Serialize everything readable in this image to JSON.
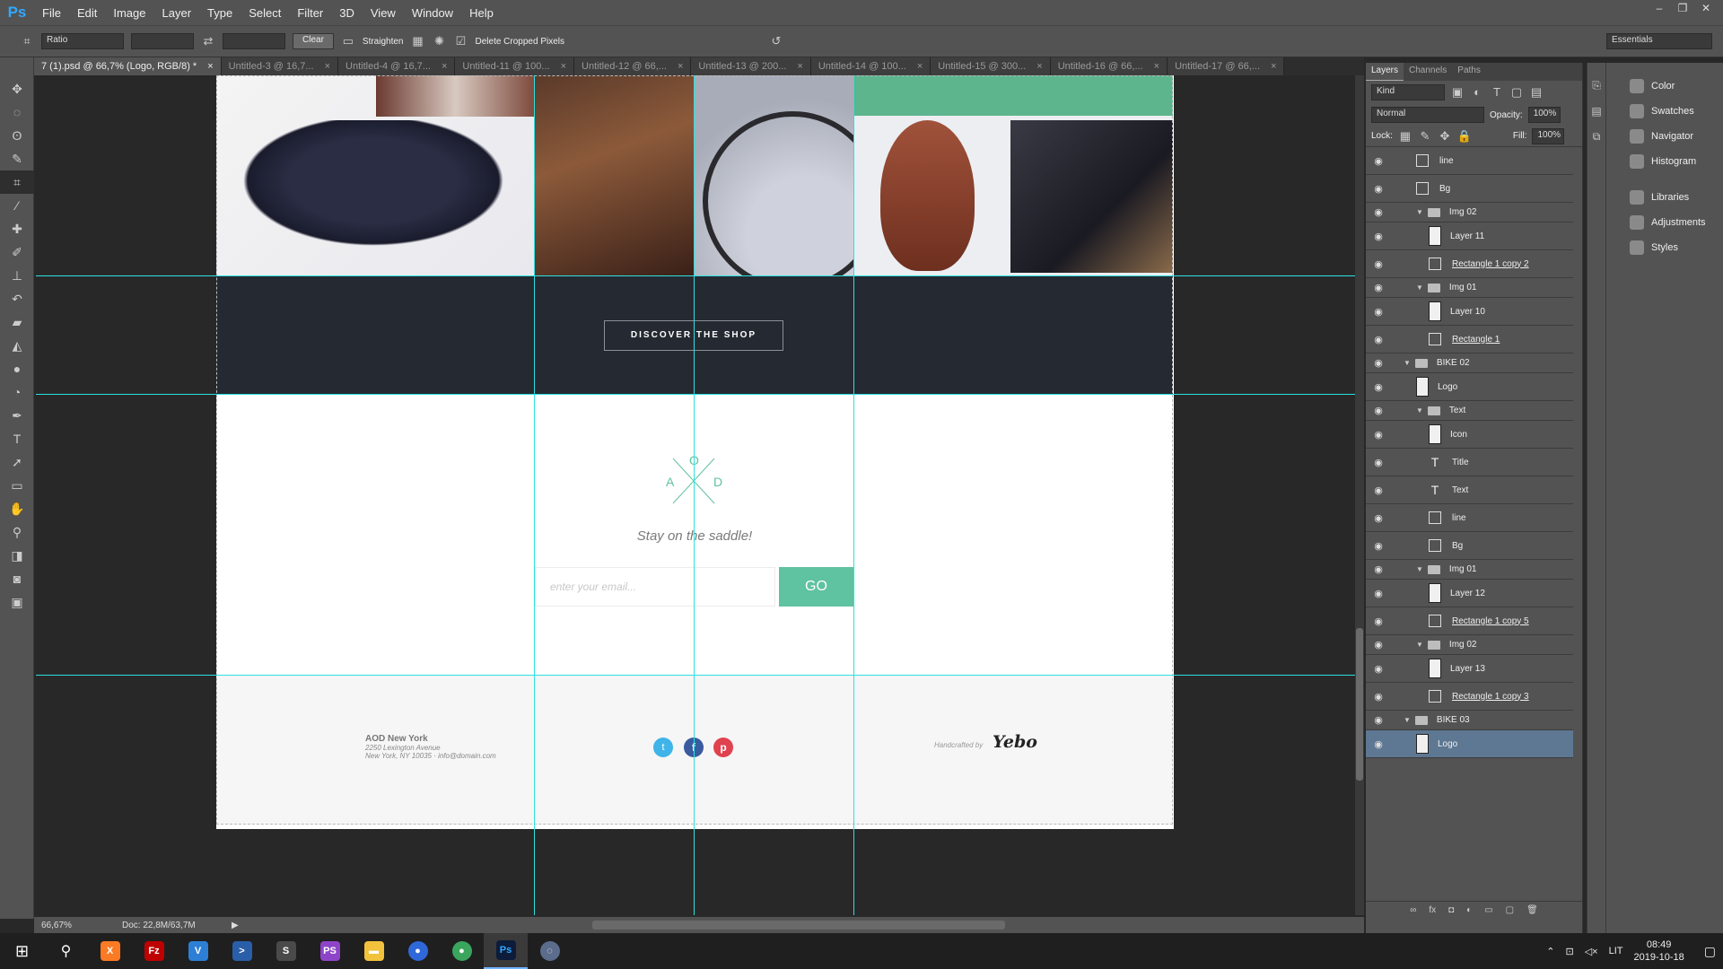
{
  "app": {
    "logo": "Ps",
    "menus": [
      "File",
      "Edit",
      "Image",
      "Layer",
      "Type",
      "Select",
      "Filter",
      "3D",
      "View",
      "Window",
      "Help"
    ],
    "window_controls": [
      "–",
      "❐",
      "✕"
    ]
  },
  "options": {
    "ratio": "Ratio",
    "clear": "Clear",
    "straighten": "Straighten",
    "delete_cropped": "Delete Cropped Pixels",
    "workspace": "Essentials"
  },
  "tabs": [
    "7 (1).psd @ 66,7% (Logo, RGB/8) *",
    "Untitled-3 @ 16,7...",
    "Untitled-4 @ 16,7...",
    "Untitled-11 @ 100...",
    "Untitled-12 @ 66,...",
    "Untitled-13 @ 200...",
    "Untitled-14 @ 100...",
    "Untitled-15 @ 300...",
    "Untitled-16 @ 66,...",
    "Untitled-17 @ 66,..."
  ],
  "design": {
    "cta": "DISCOVER THE SHOP",
    "logo_letters": {
      "top": "O",
      "left": "A",
      "right": "D"
    },
    "tagline": "Stay on the saddle!",
    "email_placeholder": "enter your email...",
    "go": "GO",
    "footer": {
      "company": "AOD New York",
      "address": "2250 Lexington Avenue",
      "city": "New York, NY 10035 · info@domain.com",
      "handcrafted": "Handcrafted by",
      "brand": "Yebo"
    },
    "accent": "#5fc2a0"
  },
  "status": {
    "zoom": "66,67%",
    "doc": "Doc: 22,8M/63,7M"
  },
  "panels": {
    "tabs": [
      "Layers",
      "Channels",
      "Paths"
    ],
    "kind": "Kind",
    "blend": "Normal",
    "opacity_label": "Opacity:",
    "opacity": "100%",
    "lock_label": "Lock:",
    "fill_label": "Fill:",
    "fill": "100%",
    "layers": [
      {
        "name": "line",
        "type": "shape",
        "indent": 2
      },
      {
        "name": "Bg",
        "type": "shape",
        "indent": 2
      },
      {
        "name": "Img 02",
        "type": "group",
        "indent": 2
      },
      {
        "name": "Layer 11",
        "type": "pixel",
        "indent": 3
      },
      {
        "name": "Rectangle 1 copy 2",
        "type": "shape",
        "indent": 3,
        "u": true
      },
      {
        "name": "Img 01",
        "type": "group",
        "indent": 2
      },
      {
        "name": "Layer 10",
        "type": "pixel",
        "indent": 3
      },
      {
        "name": "Rectangle 1",
        "type": "shape",
        "indent": 3,
        "u": true
      },
      {
        "name": "BIKE 02",
        "type": "group",
        "indent": 1
      },
      {
        "name": "Logo",
        "type": "pixel",
        "indent": 2
      },
      {
        "name": "Text",
        "type": "group",
        "indent": 2
      },
      {
        "name": "Icon",
        "type": "pixel",
        "indent": 3
      },
      {
        "name": "Title",
        "type": "text",
        "indent": 3
      },
      {
        "name": "Text",
        "type": "text",
        "indent": 3
      },
      {
        "name": "line",
        "type": "shape",
        "indent": 3
      },
      {
        "name": "Bg",
        "type": "shape",
        "indent": 3
      },
      {
        "name": "Img 01",
        "type": "group",
        "indent": 2
      },
      {
        "name": "Layer 12",
        "type": "pixel",
        "indent": 3
      },
      {
        "name": "Rectangle 1 copy 5",
        "type": "shape",
        "indent": 3,
        "u": true
      },
      {
        "name": "Img 02",
        "type": "group",
        "indent": 2
      },
      {
        "name": "Layer 13",
        "type": "pixel",
        "indent": 3
      },
      {
        "name": "Rectangle 1 copy 3",
        "type": "shape",
        "indent": 3,
        "u": true
      },
      {
        "name": "BIKE 03",
        "type": "group",
        "indent": 1
      },
      {
        "name": "Logo",
        "type": "pixel",
        "indent": 2,
        "selected": true
      }
    ],
    "right": [
      "Color",
      "Swatches",
      "Navigator",
      "Histogram",
      "Libraries",
      "Adjustments",
      "Styles"
    ]
  },
  "taskbar": {
    "lang": "LIT",
    "time": "08:49",
    "date": "2019-10-18"
  }
}
